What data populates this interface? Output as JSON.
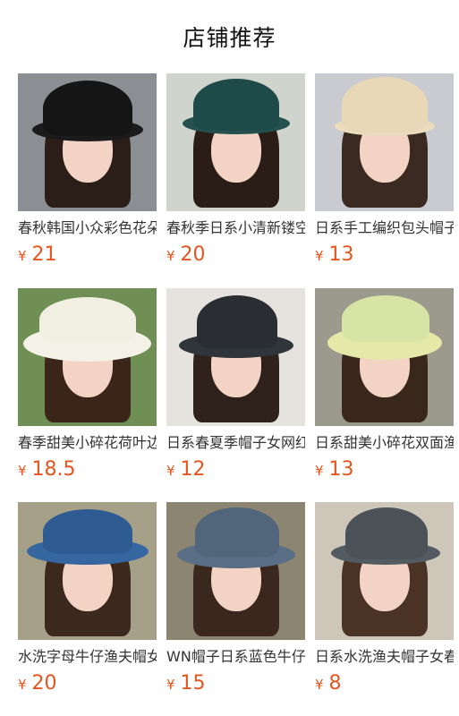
{
  "page": {
    "title": "店铺推荐"
  },
  "products": [
    {
      "title": "春秋韩国小众彩色花朵",
      "currency": "¥",
      "price": "21",
      "colors": {
        "bg": "#8b8f93",
        "hair": "#2b1d17",
        "hat": "#151515",
        "brim": "#1b1b1b"
      }
    },
    {
      "title": "春秋季日系小清新镂空",
      "currency": "¥",
      "price": "20",
      "colors": {
        "bg": "#cfd4cc",
        "hair": "#2a1c16",
        "hat": "#1f4a4a",
        "brim": "#24514f"
      }
    },
    {
      "title": "日系手工编织包头帽子",
      "currency": "¥",
      "price": "13",
      "colors": {
        "bg": "#c9cbd0",
        "hair": "#3a2a22",
        "hat": "#e8d8b8",
        "brim": "#eadcbd"
      }
    },
    {
      "title": "春季甜美小碎花荷叶边",
      "currency": "¥",
      "price": "18.5",
      "colors": {
        "bg": "#6f8f54",
        "hair": "#3a2518",
        "hat": "#f1eee2",
        "brim": "#f4f1e6"
      }
    },
    {
      "title": "日系春夏季帽子女网红",
      "currency": "¥",
      "price": "12",
      "colors": {
        "bg": "#e6e3df",
        "hair": "#2f211b",
        "hat": "#2a2e33",
        "brim": "#30353b"
      }
    },
    {
      "title": "日系甜美小碎花双面渔",
      "currency": "¥",
      "price": "13",
      "colors": {
        "bg": "#9b9a8d",
        "hair": "#3a271b",
        "hat": "#d8e3a6",
        "brim": "#e5e9a8"
      }
    },
    {
      "title": "水洗字母牛仔渔夫帽女",
      "currency": "¥",
      "price": "20",
      "colors": {
        "bg": "#a7a089",
        "hair": "#3b291e",
        "hat": "#2e5c92",
        "brim": "#3566a0"
      }
    },
    {
      "title": "WN帽子日系蓝色牛仔渔",
      "currency": "¥",
      "price": "15",
      "colors": {
        "bg": "#8b8571",
        "hair": "#3a281e",
        "hat": "#51657b",
        "brim": "#5a6f86"
      }
    },
    {
      "title": "日系水洗渔夫帽子女春",
      "currency": "¥",
      "price": "8",
      "colors": {
        "bg": "#cfc6ba",
        "hair": "#4a3325",
        "hat": "#4b5258",
        "brim": "#535b62"
      }
    }
  ]
}
